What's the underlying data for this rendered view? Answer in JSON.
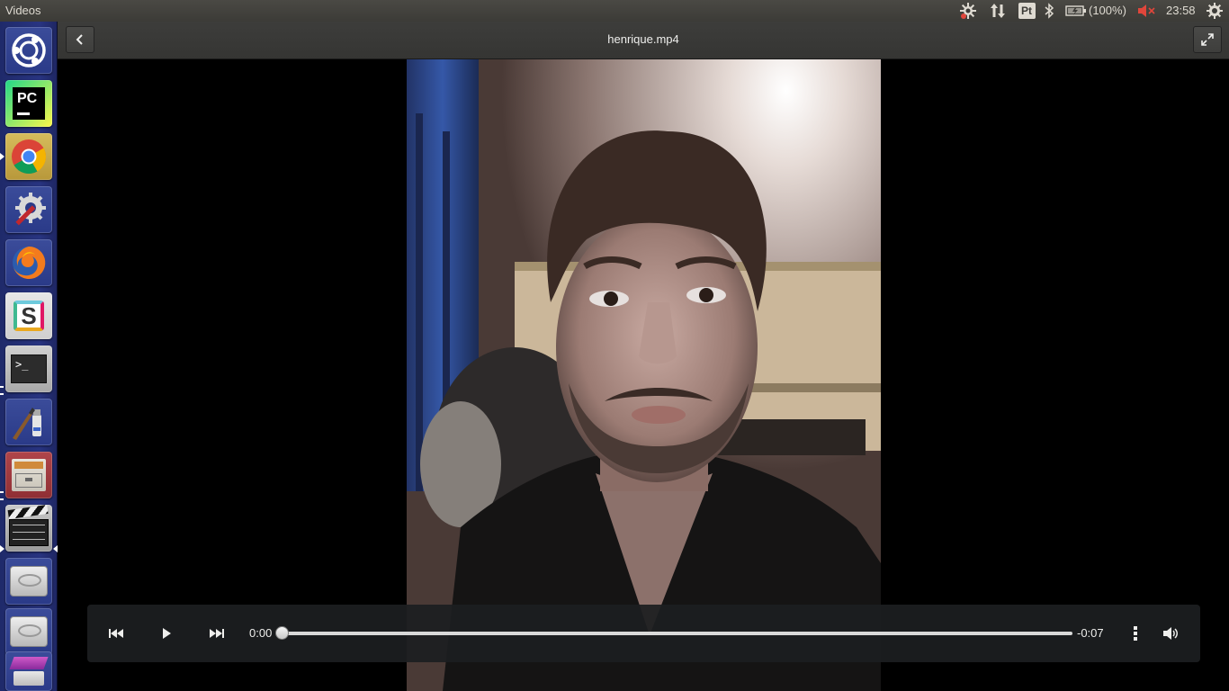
{
  "top_panel": {
    "app_name": "Videos",
    "pt_label": "Pt",
    "battery_text": "(100%)",
    "clock": "23:58",
    "icons": [
      "settings-alert-icon",
      "network-icon",
      "bluetooth-icon",
      "battery-icon",
      "volume-muted-icon",
      "session-gear-icon"
    ],
    "muted_color": "#e0463b"
  },
  "launcher": {
    "items": [
      {
        "name": "dash",
        "icon": "ubuntu-logo-icon",
        "running": false
      },
      {
        "name": "pycharm",
        "icon": "pycharm-icon",
        "running": false
      },
      {
        "name": "chrome",
        "icon": "chrome-icon",
        "running": true
      },
      {
        "name": "system-settings",
        "icon": "settings-wrench-icon",
        "running": false
      },
      {
        "name": "firefox",
        "icon": "firefox-icon",
        "running": false
      },
      {
        "name": "slack",
        "icon": "slack-icon",
        "running": false
      },
      {
        "name": "terminal",
        "icon": "terminal-icon",
        "running": true
      },
      {
        "name": "drawing",
        "icon": "paint-brush-icon",
        "running": false
      },
      {
        "name": "file-archive",
        "icon": "cabinet-icon",
        "running": true
      },
      {
        "name": "videos",
        "icon": "clapperboard-icon",
        "running": true,
        "focused": true
      },
      {
        "name": "drive-1",
        "icon": "hard-drive-icon",
        "running": false
      },
      {
        "name": "drive-2",
        "icon": "hard-drive-icon",
        "running": false
      },
      {
        "name": "installer",
        "icon": "installer-icon",
        "running": false
      }
    ]
  },
  "header": {
    "title": "henrique.mp4"
  },
  "player": {
    "elapsed": "0:00",
    "remaining": "-0:07",
    "progress": 0.0
  }
}
